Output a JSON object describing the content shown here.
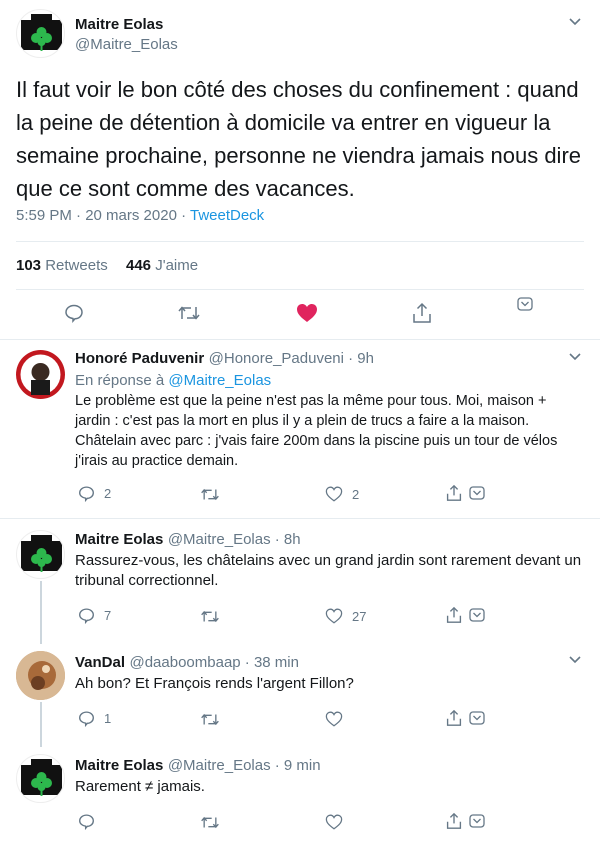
{
  "main_tweet": {
    "author_name": "Maitre Eolas",
    "author_handle": "@Maitre_Eolas",
    "text": "Il faut voir le bon côté des choses du confinement : quand la peine de détention à domicile va entrer en vigueur la semaine prochaine, personne ne viendra jamais nous dire que ce sont comme des vacances.",
    "time": "5:59 PM · 20 mars 2020 · ",
    "source": "TweetDeck",
    "retweets_count": "103",
    "retweets_label": "Retweets",
    "likes_count": "446",
    "likes_label": "J'aime"
  },
  "replies": [
    {
      "author_name": "Honoré Paduvenir",
      "meta": "@Honore_Paduveni · 9h",
      "reply_to_prefix": "En réponse à ",
      "reply_to_handle": "@Maitre_Eolas",
      "text": "Le problème est que la peine n'est pas la même pour tous. Moi, maison + jardin : c'est pas la mort en plus il y a plein de trucs a faire a la maison. Châtelain avec parc : j'vais faire 200m dans la piscine puis un tour de vélos j'irais au practice demain.",
      "reply_count": "2",
      "retweet_count": "",
      "like_count": "2"
    },
    {
      "author_name": "Maitre Eolas",
      "meta": "@Maitre_Eolas · 8h",
      "text": "Rassurez-vous, les châtelains avec un grand jardin sont rarement devant un tribunal correctionnel.",
      "reply_count": "7",
      "retweet_count": "",
      "like_count": "27"
    },
    {
      "author_name": "VanDal",
      "meta": "@daaboombaap · 38 min",
      "text": "Ah bon? Et François rends l'argent Fillon?",
      "reply_count": "1",
      "retweet_count": "",
      "like_count": ""
    },
    {
      "author_name": "Maitre Eolas",
      "meta": "@Maitre_Eolas · 9 min",
      "text": "Rarement ≠ jamais.",
      "reply_count": "",
      "retweet_count": "",
      "like_count": ""
    }
  ],
  "colors": {
    "link": "#1b95e0",
    "like_active": "#e0245e",
    "icon": "#657786",
    "divider": "#e6ecf0"
  },
  "icons": [
    "chevron-down-icon",
    "reply-icon",
    "retweet-icon",
    "heart-icon",
    "share-icon",
    "dismiss-icon"
  ]
}
